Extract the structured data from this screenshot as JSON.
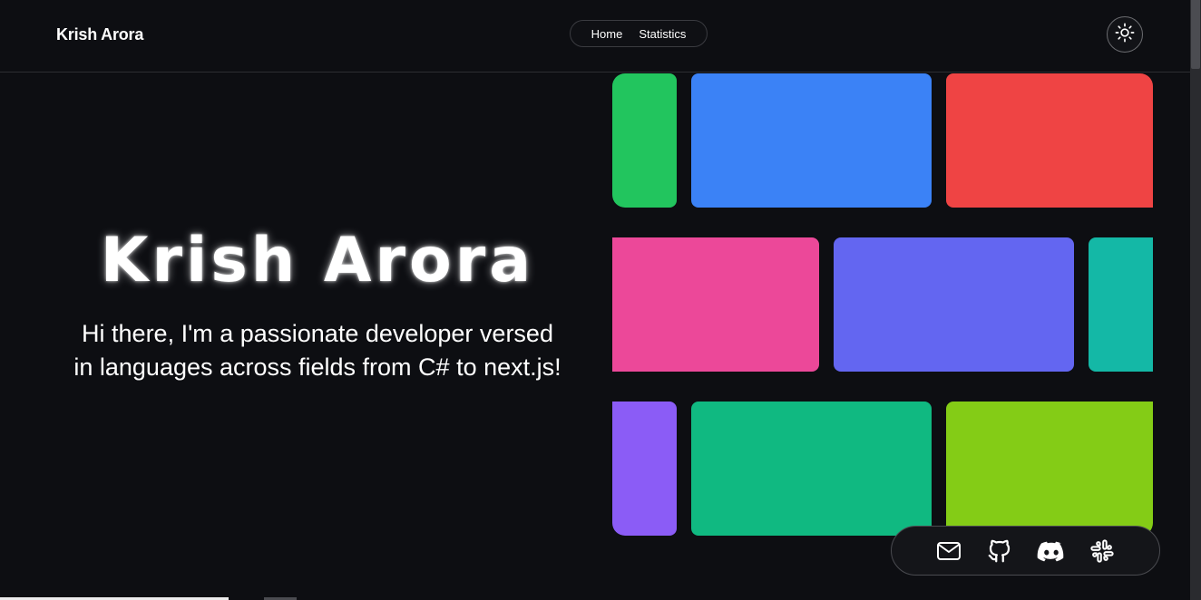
{
  "header": {
    "brand": "Krish Arora",
    "nav": [
      "Home",
      "Statistics"
    ],
    "theme_toggle_icon": "sun-icon"
  },
  "hero": {
    "name": "Krish Arora",
    "line1": "Hi there, I'm a passionate developer versed",
    "line2": "in languages across fields from C# to next.js!"
  },
  "tiles": {
    "colors": [
      "#22c55e",
      "#3b82f6",
      "#ef4444",
      "#ec4899",
      "#6366f1",
      "#14b8a6",
      "#8b5cf6",
      "#10b981",
      "#84cc16"
    ]
  },
  "socials": {
    "icons": [
      "mail-icon",
      "github-icon",
      "discord-icon",
      "slack-icon"
    ]
  }
}
